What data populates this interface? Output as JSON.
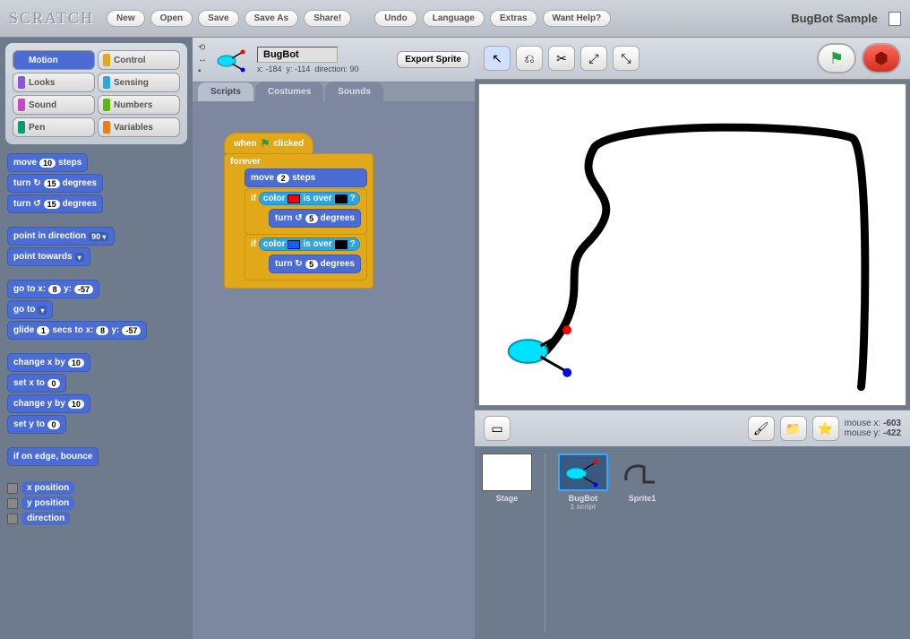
{
  "logo": "SCRATCH",
  "toolbar": [
    "New",
    "Open",
    "Save",
    "Save As",
    "Share!"
  ],
  "toolbar2": [
    "Undo",
    "Language",
    "Extras",
    "Want Help?"
  ],
  "project_title": "BugBot Sample",
  "categories": [
    {
      "name": "Motion",
      "color": "#4a6cd4",
      "active": true
    },
    {
      "name": "Control",
      "color": "#e1a91a"
    },
    {
      "name": "Looks",
      "color": "#8a55d7"
    },
    {
      "name": "Sensing",
      "color": "#2ca5e2"
    },
    {
      "name": "Sound",
      "color": "#c14ac1"
    },
    {
      "name": "Numbers",
      "color": "#5cb712"
    },
    {
      "name": "Pen",
      "color": "#0e9a6c"
    },
    {
      "name": "Variables",
      "color": "#ee7d16"
    }
  ],
  "palette": {
    "move_steps": {
      "t": "move",
      "v": "10",
      "t2": "steps"
    },
    "turn_cw": {
      "t": "turn ↻",
      "v": "15",
      "t2": "degrees"
    },
    "turn_ccw": {
      "t": "turn ↺",
      "v": "15",
      "t2": "degrees"
    },
    "point_dir": {
      "t": "point in direction",
      "v": "90"
    },
    "point_towards": {
      "t": "point towards",
      "v": ""
    },
    "goto_xy": {
      "t": "go to x:",
      "x": "8",
      "t2": "y:",
      "y": "-57"
    },
    "goto": {
      "t": "go to",
      "v": ""
    },
    "glide": {
      "t": "glide",
      "s": "1",
      "t2": "secs to x:",
      "x": "8",
      "t3": "y:",
      "y": "-57"
    },
    "change_x": {
      "t": "change x by",
      "v": "10"
    },
    "set_x": {
      "t": "set x to",
      "v": "0"
    },
    "change_y": {
      "t": "change y by",
      "v": "10"
    },
    "set_y": {
      "t": "set y to",
      "v": "0"
    },
    "edge": {
      "t": "if on edge, bounce"
    },
    "reporters": [
      "x position",
      "y position",
      "direction"
    ]
  },
  "sprite": {
    "name": "BugBot",
    "x": "-184",
    "y": "-114",
    "dir": "90",
    "export": "Export Sprite"
  },
  "tabs": [
    "Scripts",
    "Costumes",
    "Sounds"
  ],
  "script": {
    "hat": "when",
    "hat2": "clicked",
    "forever": "forever",
    "move": {
      "t": "move",
      "v": "2",
      "t2": "steps"
    },
    "if1": {
      "t": "if",
      "cond_t": "color",
      "c1": "#ff0000",
      "cond_t2": "is over",
      "c2": "#000000",
      "q": "?"
    },
    "turn1": {
      "t": "turn ↺",
      "v": "5",
      "t2": "degrees"
    },
    "if2": {
      "t": "if",
      "cond_t": "color",
      "c1": "#0066ff",
      "cond_t2": "is over",
      "c2": "#000000",
      "q": "?"
    },
    "turn2": {
      "t": "turn ↻",
      "v": "5",
      "t2": "degrees"
    }
  },
  "stage_tools": [
    "pointer",
    "stamp",
    "cut",
    "grow",
    "shrink"
  ],
  "mouse": {
    "xl": "mouse x:",
    "x": "-603",
    "yl": "mouse y:",
    "y": "-422"
  },
  "below": {
    "present": "▣",
    "paint": "✎",
    "folder": "📁",
    "surprise": "★"
  },
  "stage_label": "Stage",
  "sprites": [
    {
      "name": "BugBot",
      "sub": "1 script",
      "sel": true
    },
    {
      "name": "Sprite1",
      "sub": ""
    }
  ]
}
